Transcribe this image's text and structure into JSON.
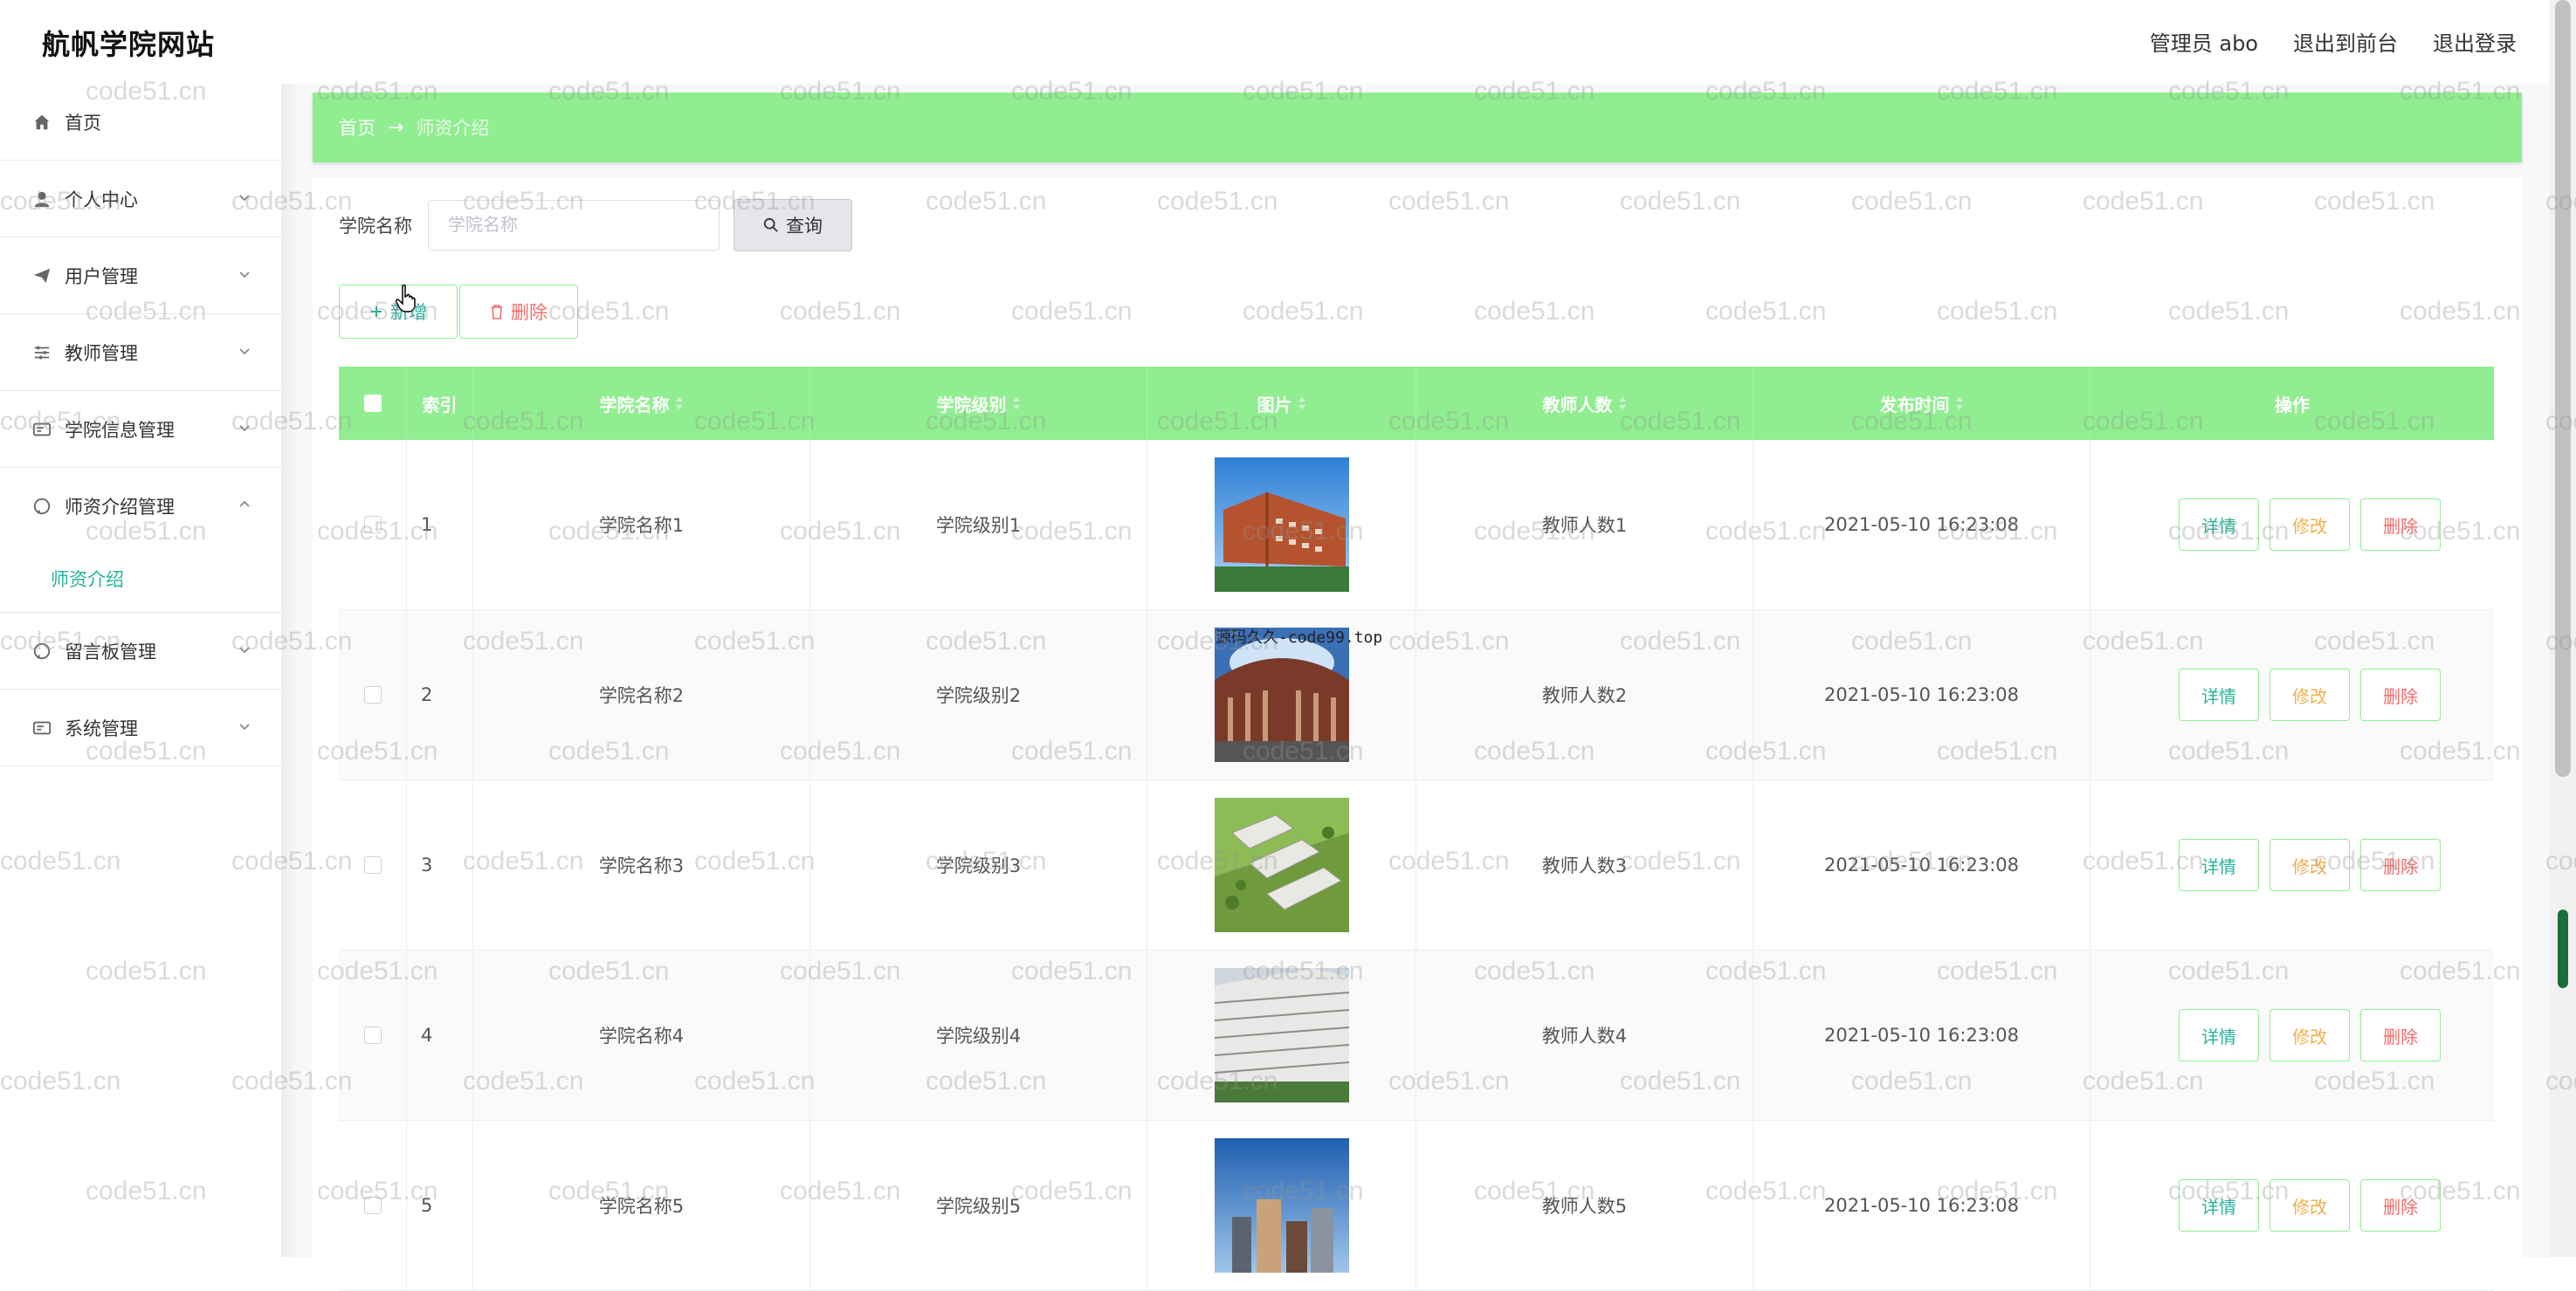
{
  "header": {
    "site_title": "航帆学院网站",
    "user_label": "管理员 abo",
    "front_link": "退出到前台",
    "logout_link": "退出登录"
  },
  "sidebar": {
    "items": [
      {
        "label": "首页",
        "icon": "home-icon",
        "has_chevron": false
      },
      {
        "label": "个人中心",
        "icon": "user-icon",
        "has_chevron": true
      },
      {
        "label": "用户管理",
        "icon": "send-icon",
        "has_chevron": true
      },
      {
        "label": "教师管理",
        "icon": "sliders-icon",
        "has_chevron": true
      },
      {
        "label": "学院信息管理",
        "icon": "card-icon",
        "has_chevron": true
      },
      {
        "label": "师资介绍管理",
        "icon": "chat-icon",
        "has_chevron": true,
        "expanded": true
      },
      {
        "label": "留言板管理",
        "icon": "chat-icon",
        "has_chevron": true
      },
      {
        "label": "系统管理",
        "icon": "card-icon",
        "has_chevron": true
      }
    ],
    "active_sub": "师资介绍"
  },
  "breadcrumb": {
    "home": "首页",
    "arrow": "→",
    "current": "师资介绍"
  },
  "search": {
    "label": "学院名称",
    "placeholder": "学院名称",
    "button": "查询"
  },
  "actions": {
    "add": "新增",
    "delete": "删除"
  },
  "table": {
    "columns": [
      "索引",
      "学院名称",
      "学院级别",
      "图片",
      "教师人数",
      "发布时间",
      "操作"
    ],
    "rows": [
      {
        "index": "1",
        "name": "学院名称1",
        "level": "学院级别1",
        "count": "教师人数1",
        "time": "2021-05-10 16:23:08"
      },
      {
        "index": "2",
        "name": "学院名称2",
        "level": "学院级别2",
        "count": "教师人数2",
        "time": "2021-05-10 16:23:08"
      },
      {
        "index": "3",
        "name": "学院名称3",
        "level": "学院级别3",
        "count": "教师人数3",
        "time": "2021-05-10 16:23:08"
      },
      {
        "index": "4",
        "name": "学院名称4",
        "level": "学院级别4",
        "count": "教师人数4",
        "time": "2021-05-10 16:23:08"
      },
      {
        "index": "5",
        "name": "学院名称5",
        "level": "学院级别5",
        "count": "教师人数5",
        "time": "2021-05-10 16:23:08"
      }
    ],
    "ops": {
      "detail": "详情",
      "edit": "修改",
      "remove": "删除"
    }
  },
  "overlay_text": "源码久久-code99.top",
  "watermark": "code51.cn",
  "colors": {
    "accent_green": "#90ee90",
    "teal_text": "#25b39a",
    "delete_red": "#f56c6c",
    "edit_orange": "#f0b04a"
  }
}
